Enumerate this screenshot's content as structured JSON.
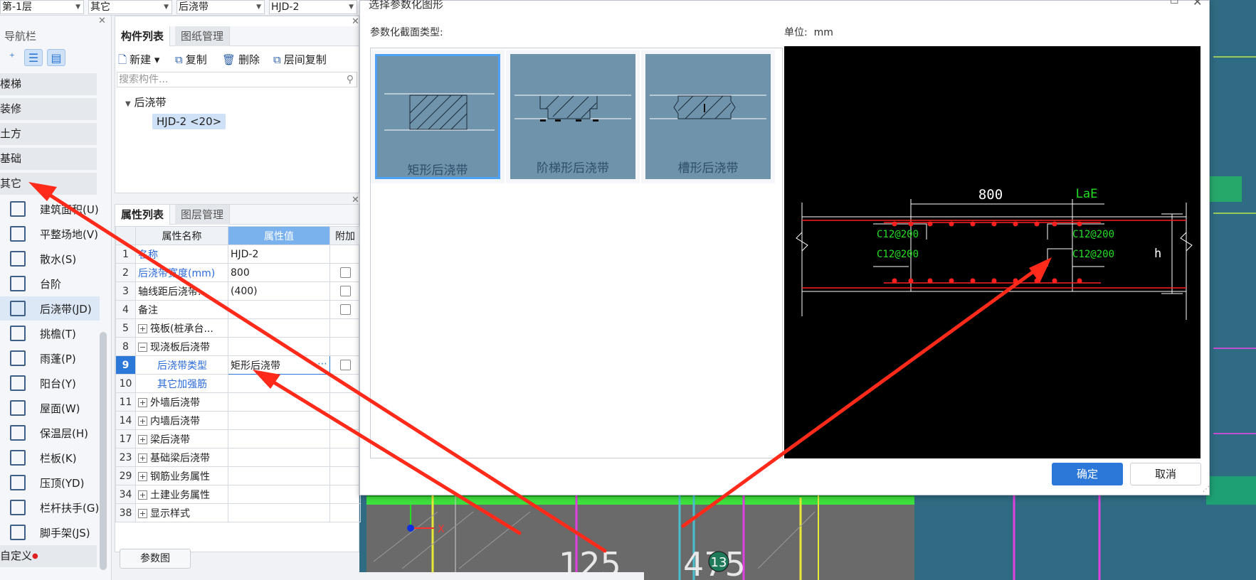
{
  "topbar": {
    "floor": "第-1层",
    "category": "其它",
    "type": "后浇带",
    "component": "HJD-2"
  },
  "nav": {
    "title": "导航栏",
    "categories": [
      "楼梯",
      "装修",
      "土方",
      "基础",
      "其它"
    ],
    "items": [
      {
        "label": "建筑面积(U)",
        "icon": "area-icon"
      },
      {
        "label": "平整场地(V)",
        "icon": "site-level-icon"
      },
      {
        "label": "散水(S)",
        "icon": "apron-icon"
      },
      {
        "label": "台阶",
        "icon": "steps-icon"
      },
      {
        "label": "后浇带(JD)",
        "icon": "post-pour-strip-icon"
      },
      {
        "label": "挑檐(T)",
        "icon": "cornice-icon"
      },
      {
        "label": "雨蓬(P)",
        "icon": "canopy-icon"
      },
      {
        "label": "阳台(Y)",
        "icon": "balcony-icon"
      },
      {
        "label": "屋面(W)",
        "icon": "roof-icon"
      },
      {
        "label": "保温层(H)",
        "icon": "insulation-icon"
      },
      {
        "label": "栏板(K)",
        "icon": "parapet-icon"
      },
      {
        "label": "压顶(YD)",
        "icon": "coping-icon"
      },
      {
        "label": "栏杆扶手(G)",
        "icon": "railing-icon"
      },
      {
        "label": "脚手架(JS)",
        "icon": "scaffold-icon"
      }
    ],
    "custom": "自定义"
  },
  "comp": {
    "tabs": [
      "构件列表",
      "图纸管理"
    ],
    "actions": [
      "新建",
      "复制",
      "删除",
      "层间复制"
    ],
    "search_placeholder": "搜索构件...",
    "tree_root": "后浇带",
    "tree_item": "HJD-2 <20>"
  },
  "props": {
    "tabs": [
      "属性列表",
      "图层管理"
    ],
    "headers": [
      "属性名称",
      "属性值",
      "附加"
    ],
    "rows": [
      {
        "n": "1",
        "name": "名称",
        "value": "HJD-2"
      },
      {
        "n": "2",
        "name": "后浇带宽度(mm)",
        "value": "800"
      },
      {
        "n": "3",
        "name": "轴线距后浇带...",
        "value": "(400)"
      },
      {
        "n": "4",
        "name": "备注",
        "value": ""
      },
      {
        "n": "5",
        "name": "筏板(桩承台...",
        "value": ""
      },
      {
        "n": "8",
        "name": "现浇板后浇带",
        "value": ""
      },
      {
        "n": "9",
        "name": "后浇带类型",
        "value": "矩形后浇带"
      },
      {
        "n": "10",
        "name": "其它加强筋",
        "value": ""
      },
      {
        "n": "11",
        "name": "外墙后浇带",
        "value": ""
      },
      {
        "n": "14",
        "name": "内墙后浇带",
        "value": ""
      },
      {
        "n": "17",
        "name": "梁后浇带",
        "value": ""
      },
      {
        "n": "23",
        "name": "基础梁后浇带",
        "value": ""
      },
      {
        "n": "29",
        "name": "钢筋业务属性",
        "value": ""
      },
      {
        "n": "34",
        "name": "土建业务属性",
        "value": ""
      },
      {
        "n": "38",
        "name": "显示样式",
        "value": ""
      }
    ],
    "param_button": "参数图"
  },
  "dialog": {
    "title": "选择参数化图形",
    "section_label": "参数化截面类型:",
    "unit_label": "单位:",
    "unit_value": "mm",
    "shapes": [
      "矩形后浇带",
      "阶梯形后浇带",
      "槽形后浇带"
    ],
    "preview": {
      "width": "800",
      "anchor": "LaE",
      "rebar": "C12@200",
      "height": "h"
    },
    "ok": "确定",
    "cancel": "取消"
  },
  "canvas": {
    "dim1": "125",
    "dim2": "475",
    "axis_no": "13",
    "axis_label": "X"
  },
  "colors": {
    "accent": "#2b78d8",
    "annotation": "#ff2a1a",
    "cad_green": "#22dd22",
    "cad_red": "#ff2020"
  }
}
